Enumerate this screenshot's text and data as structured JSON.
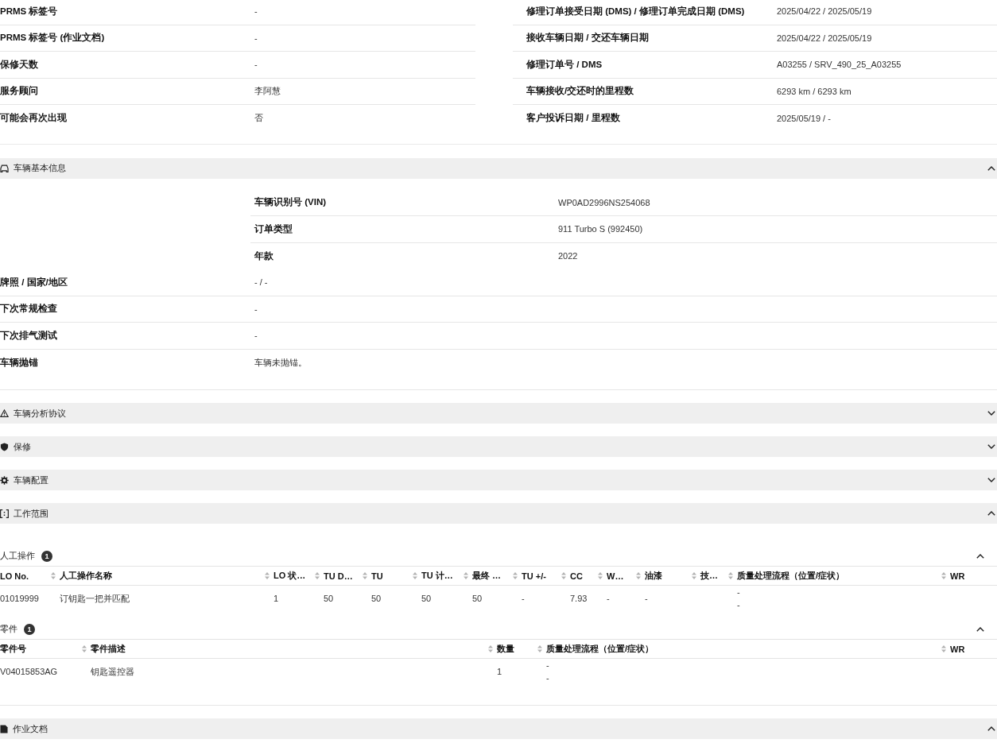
{
  "order_details": {
    "left_column": [
      {
        "label": "PRMS 标签号",
        "value": "-"
      },
      {
        "label": "PRMS 标签号 (作业文档)",
        "value": "-"
      },
      {
        "label": "保修天数",
        "value": "-"
      },
      {
        "label": "服务顾问",
        "value": "李阿慧"
      },
      {
        "label": "可能会再次出现",
        "value": "否"
      }
    ],
    "right_column": [
      {
        "label": "修理订单接受日期 (DMS) / 修理订单完成日期 (DMS)",
        "value": "2025/04/22 / 2025/05/19"
      },
      {
        "label": "接收车辆日期 / 交还车辆日期",
        "value": "2025/04/22 / 2025/05/19"
      },
      {
        "label": "修理订单号 / DMS",
        "value": "A03255 / SRV_490_25_A03255"
      },
      {
        "label": "车辆接收/交还时的里程数",
        "value": "6293 km / 6293 km"
      },
      {
        "label": "客户投诉日期 / 里程数",
        "value": "2025/05/19 / -"
      }
    ]
  },
  "sections": [
    {
      "title": "车辆基本信息",
      "expanded": true,
      "top_rows": [
        {
          "label": "车辆识别号 (VIN)",
          "value": "WP0AD2996NS254068"
        },
        {
          "label": "订单类型",
          "value": "911 Turbo S (992450)"
        },
        {
          "label": "年款",
          "value": "2022"
        }
      ],
      "rows": [
        {
          "label": "牌照 / 国家/地区",
          "value": "- / -"
        },
        {
          "label": "下次常规检查",
          "value": "-"
        },
        {
          "label": "下次排气测试",
          "value": "-"
        },
        {
          "label": "车辆抛锚",
          "value": "车辆未抛锚。"
        }
      ]
    },
    {
      "title": "车辆分析协议",
      "expanded": false
    },
    {
      "title": "保修",
      "expanded": false
    },
    {
      "title": "车辆配置",
      "expanded": false
    },
    {
      "title": "工作范围",
      "expanded": true,
      "tables": [
        {
          "title": "人工操作",
          "count": "1",
          "expanded": true,
          "columns": [
            {
              "label": "LO No.",
              "sortable": false
            },
            {
              "label": "人工操作名称",
              "sortable": true
            },
            {
              "label": "LO 状…",
              "sortable": true
            },
            {
              "label": "TU D…",
              "sortable": true
            },
            {
              "label": "TU",
              "sortable": true
            },
            {
              "label": "TU 计…",
              "sortable": true
            },
            {
              "label": "最终 …",
              "sortable": true
            },
            {
              "label": "TU +/-",
              "sortable": true
            },
            {
              "label": "CC",
              "sortable": true
            },
            {
              "label": "W…",
              "sortable": true
            },
            {
              "label": "油漆",
              "sortable": true
            },
            {
              "label": "技…",
              "sortable": true
            },
            {
              "label": "质量处理流程（位置/症状）",
              "sortable": true
            },
            {
              "label": "WR",
              "sortable": true
            }
          ],
          "rows": [
            [
              "01019999",
              "订钥匙一把并匹配",
              "1",
              "50",
              "50",
              "50",
              "50",
              "-",
              "7.93",
              "-",
              "-",
              null,
              [
                "-",
                "-"
              ],
              null
            ]
          ]
        },
        {
          "title": "零件",
          "count": "1",
          "expanded": true,
          "columns": [
            {
              "label": "零件号",
              "sortable": false
            },
            {
              "label": "零件描述",
              "sortable": true
            },
            {
              "label": "数量",
              "sortable": true
            },
            {
              "label": "质量处理流程（位置/症状）",
              "sortable": true
            },
            {
              "label": "WR",
              "sortable": true
            }
          ],
          "rows": [
            [
              "V04015853AG",
              "钥匙遥控器",
              "1",
              [
                "-",
                "-"
              ],
              null
            ]
          ]
        }
      ]
    },
    {
      "title": "作业文档",
      "expanded": true
    }
  ]
}
